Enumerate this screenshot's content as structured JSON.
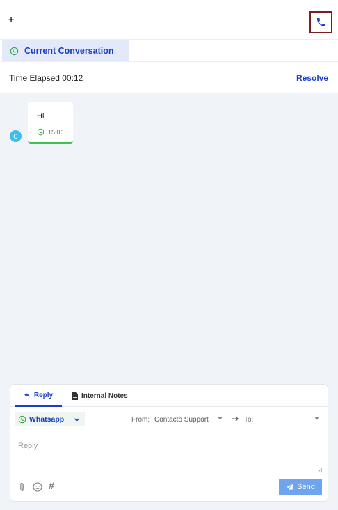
{
  "topbar": {
    "plus_label": "+"
  },
  "tabs": [
    {
      "label": "Current Conversation"
    }
  ],
  "conversation": {
    "elapsed_label": "Time Elapsed 00:12",
    "resolve_label": "Resolve",
    "messages": [
      {
        "avatar": "C",
        "text": "Hi",
        "time": "15:06"
      }
    ]
  },
  "composer": {
    "tabs": {
      "reply": "Reply",
      "notes": "Internal Notes"
    },
    "channel": "Whatsapp",
    "from_label": "From:",
    "from_value": "Contacto Support",
    "to_label": "To:",
    "reply_placeholder": "Reply",
    "send_label": "Send"
  },
  "colors": {
    "accent": "#1d3fc7",
    "whatsapp": "#25a244",
    "send": "#6fa5ef",
    "avatar": "#3dbcf0"
  }
}
